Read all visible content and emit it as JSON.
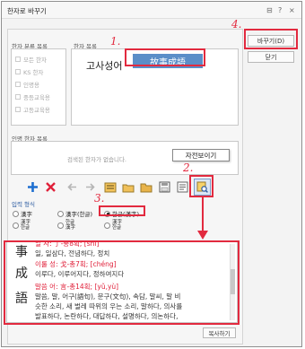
{
  "window": {
    "title": "한자로 바꾸기"
  },
  "titlebar": {
    "restore_glyph": "⊟",
    "help_glyph": "?",
    "close_glyph": "×"
  },
  "labels": {
    "category_list": "한자 분류 목록",
    "hanja_list": "한자 목록",
    "recent_list": "인명 한자 목록",
    "input_style": "입력 형식"
  },
  "categories": [
    "모든 한자",
    "KS 한자",
    "인명용",
    "중등교육용",
    "고등교육용"
  ],
  "conversion": {
    "hangul": "고사성어",
    "hanja": "故事成語"
  },
  "empty_message": "검색된 한자가 없습니다.",
  "buttons": {
    "replace": "바꾸기(D)",
    "close": "닫기",
    "copy": "복사하기"
  },
  "tooltip": "자전보이기",
  "input_styles": [
    {
      "top": "漢字",
      "bottom": "",
      "selected": false
    },
    {
      "top": "漢字(한글)",
      "bottom": "",
      "selected": false
    },
    {
      "top": "한글(漢字)",
      "bottom": "",
      "selected": true
    },
    {
      "top": "漢字",
      "bottom": "한글",
      "selected": false
    },
    {
      "top": "한글",
      "bottom": "漢字",
      "selected": false
    },
    {
      "top": "漢字",
      "bottom": "한글",
      "selected": false
    }
  ],
  "dictionary": {
    "chars": [
      "事",
      "成",
      "語"
    ],
    "lines": [
      {
        "text": "일, 일삼다, 전념하다, 정치",
        "color": "#222"
      },
      {
        "text": "이룰 성: 戈-총7획; [chéng]",
        "color": "#e0203a"
      },
      {
        "text": "이루다, 이루어지다, 정하여지다",
        "color": "#222"
      },
      {
        "text": "말씀 어: 言-총14획; [yǔ,yù]",
        "color": "#e0203a"
      },
      {
        "text": "말씀, 말, 어구(語句), 문구(文句), 속담, 말씨, 말 비",
        "color": "#222"
      },
      {
        "text": "슷한 소리, 새 벌레 따위의 우는 소리, 말하다, 의사를",
        "color": "#222"
      },
      {
        "text": "발표하다, 논란하다, 대답하다, 설명하다, 의논하다,",
        "color": "#222"
      }
    ]
  },
  "annotations": [
    "1.",
    "2.",
    "3.",
    "4."
  ],
  "colors": {
    "accent": "#1e6fd0",
    "hanja_bg": "#5b8ec8",
    "annotation": "#e22a3f"
  }
}
